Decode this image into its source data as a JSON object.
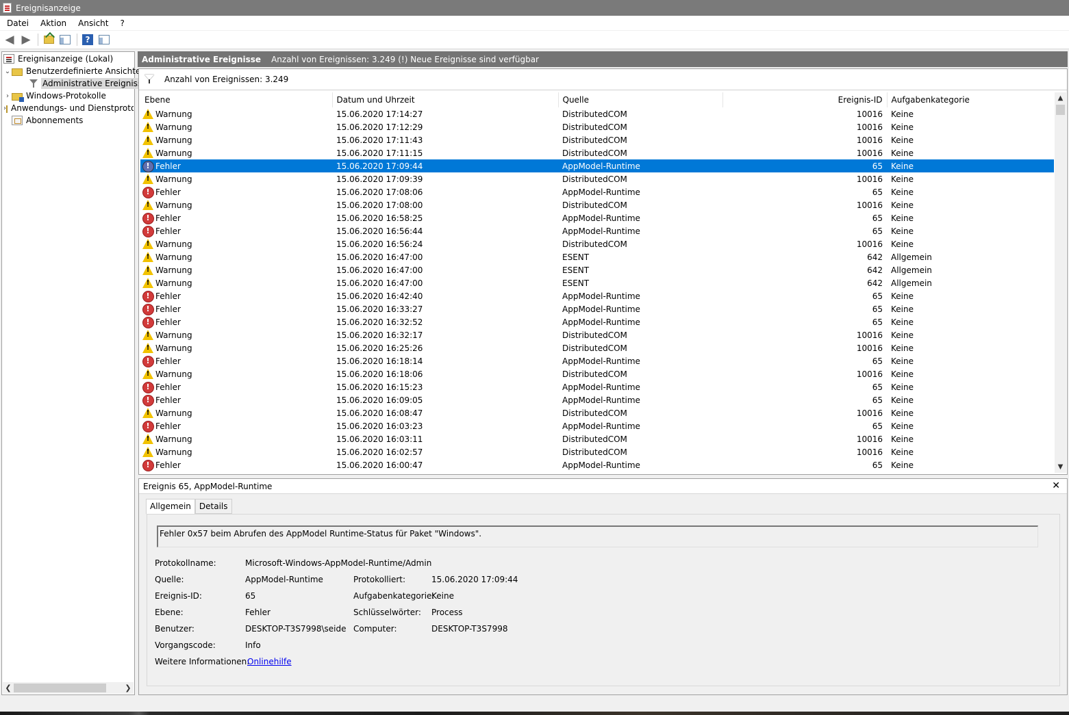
{
  "window": {
    "title": "Ereignisanzeige"
  },
  "menu": [
    "Datei",
    "Aktion",
    "Ansicht",
    "?"
  ],
  "tree": {
    "root": "Ereignisanzeige (Lokal)",
    "custom_views": "Benutzerdefinierte Ansichten",
    "admin_events": "Administrative Ereignisse",
    "windows_logs": "Windows-Protokolle",
    "app_logs": "Anwendungs- und Dienstprotokolle",
    "subscriptions": "Abonnements"
  },
  "header": {
    "title": "Administrative Ereignisse",
    "info": "Anzahl von Ereignissen: 3.249 (!) Neue Ereignisse sind verfügbar"
  },
  "filter_bar": {
    "text": "Anzahl von Ereignissen: 3.249"
  },
  "columns": [
    "Ebene",
    "Datum und Uhrzeit",
    "Quelle",
    "Ereignis-ID",
    "Aufgabenkategorie"
  ],
  "rows": [
    {
      "level": "Warnung",
      "type": "warn",
      "date": "15.06.2020 17:14:27",
      "source": "DistributedCOM",
      "id": "10016",
      "category": "Keine"
    },
    {
      "level": "Warnung",
      "type": "warn",
      "date": "15.06.2020 17:12:29",
      "source": "DistributedCOM",
      "id": "10016",
      "category": "Keine"
    },
    {
      "level": "Warnung",
      "type": "warn",
      "date": "15.06.2020 17:11:43",
      "source": "DistributedCOM",
      "id": "10016",
      "category": "Keine"
    },
    {
      "level": "Warnung",
      "type": "warn",
      "date": "15.06.2020 17:11:15",
      "source": "DistributedCOM",
      "id": "10016",
      "category": "Keine"
    },
    {
      "level": "Fehler",
      "type": "err",
      "date": "15.06.2020 17:09:44",
      "source": "AppModel-Runtime",
      "id": "65",
      "category": "Keine"
    },
    {
      "level": "Warnung",
      "type": "warn",
      "date": "15.06.2020 17:09:39",
      "source": "DistributedCOM",
      "id": "10016",
      "category": "Keine"
    },
    {
      "level": "Fehler",
      "type": "err",
      "date": "15.06.2020 17:08:06",
      "source": "AppModel-Runtime",
      "id": "65",
      "category": "Keine"
    },
    {
      "level": "Warnung",
      "type": "warn",
      "date": "15.06.2020 17:08:00",
      "source": "DistributedCOM",
      "id": "10016",
      "category": "Keine"
    },
    {
      "level": "Fehler",
      "type": "err",
      "date": "15.06.2020 16:58:25",
      "source": "AppModel-Runtime",
      "id": "65",
      "category": "Keine"
    },
    {
      "level": "Fehler",
      "type": "err",
      "date": "15.06.2020 16:56:44",
      "source": "AppModel-Runtime",
      "id": "65",
      "category": "Keine"
    },
    {
      "level": "Warnung",
      "type": "warn",
      "date": "15.06.2020 16:56:24",
      "source": "DistributedCOM",
      "id": "10016",
      "category": "Keine"
    },
    {
      "level": "Warnung",
      "type": "warn",
      "date": "15.06.2020 16:47:00",
      "source": "ESENT",
      "id": "642",
      "category": "Allgemein"
    },
    {
      "level": "Warnung",
      "type": "warn",
      "date": "15.06.2020 16:47:00",
      "source": "ESENT",
      "id": "642",
      "category": "Allgemein"
    },
    {
      "level": "Warnung",
      "type": "warn",
      "date": "15.06.2020 16:47:00",
      "source": "ESENT",
      "id": "642",
      "category": "Allgemein"
    },
    {
      "level": "Fehler",
      "type": "err",
      "date": "15.06.2020 16:42:40",
      "source": "AppModel-Runtime",
      "id": "65",
      "category": "Keine"
    },
    {
      "level": "Fehler",
      "type": "err",
      "date": "15.06.2020 16:33:27",
      "source": "AppModel-Runtime",
      "id": "65",
      "category": "Keine"
    },
    {
      "level": "Fehler",
      "type": "err",
      "date": "15.06.2020 16:32:52",
      "source": "AppModel-Runtime",
      "id": "65",
      "category": "Keine"
    },
    {
      "level": "Warnung",
      "type": "warn",
      "date": "15.06.2020 16:32:17",
      "source": "DistributedCOM",
      "id": "10016",
      "category": "Keine"
    },
    {
      "level": "Warnung",
      "type": "warn",
      "date": "15.06.2020 16:25:26",
      "source": "DistributedCOM",
      "id": "10016",
      "category": "Keine"
    },
    {
      "level": "Fehler",
      "type": "err",
      "date": "15.06.2020 16:18:14",
      "source": "AppModel-Runtime",
      "id": "65",
      "category": "Keine"
    },
    {
      "level": "Warnung",
      "type": "warn",
      "date": "15.06.2020 16:18:06",
      "source": "DistributedCOM",
      "id": "10016",
      "category": "Keine"
    },
    {
      "level": "Fehler",
      "type": "err",
      "date": "15.06.2020 16:15:23",
      "source": "AppModel-Runtime",
      "id": "65",
      "category": "Keine"
    },
    {
      "level": "Fehler",
      "type": "err",
      "date": "15.06.2020 16:09:05",
      "source": "AppModel-Runtime",
      "id": "65",
      "category": "Keine"
    },
    {
      "level": "Warnung",
      "type": "warn",
      "date": "15.06.2020 16:08:47",
      "source": "DistributedCOM",
      "id": "10016",
      "category": "Keine"
    },
    {
      "level": "Fehler",
      "type": "err",
      "date": "15.06.2020 16:03:23",
      "source": "AppModel-Runtime",
      "id": "65",
      "category": "Keine"
    },
    {
      "level": "Warnung",
      "type": "warn",
      "date": "15.06.2020 16:03:11",
      "source": "DistributedCOM",
      "id": "10016",
      "category": "Keine"
    },
    {
      "level": "Warnung",
      "type": "warn",
      "date": "15.06.2020 16:02:57",
      "source": "DistributedCOM",
      "id": "10016",
      "category": "Keine"
    },
    {
      "level": "Fehler",
      "type": "err",
      "date": "15.06.2020 16:00:47",
      "source": "AppModel-Runtime",
      "id": "65",
      "category": "Keine"
    }
  ],
  "selected_row": 4,
  "detail": {
    "title": "Ereignis 65, AppModel-Runtime",
    "tabs": [
      "Allgemein",
      "Details"
    ],
    "message": "Fehler 0x57 beim Abrufen des AppModel Runtime-Status für Paket \"Windows\".",
    "labels": {
      "log_name": "Protokollname:",
      "source": "Quelle:",
      "event_id": "Ereignis-ID:",
      "level": "Ebene:",
      "user": "Benutzer:",
      "opcode": "Vorgangscode:",
      "more_info": "Weitere Informationen:",
      "logged": "Protokolliert:",
      "task_category": "Aufgabenkategorie:",
      "keywords": "Schlüsselwörter:",
      "computer": "Computer:"
    },
    "values": {
      "log_name": "Microsoft-Windows-AppModel-Runtime/Admin",
      "source": "AppModel-Runtime",
      "event_id": "65",
      "level": "Fehler",
      "user": "DESKTOP-T3S7998\\seide",
      "opcode": "Info",
      "more_info": "Onlinehilfe",
      "logged": "15.06.2020 17:09:44",
      "task_category": "Keine",
      "keywords": "Process",
      "computer": "DESKTOP-T3S7998"
    }
  },
  "icons": {
    "warning": "warning-triangle-icon",
    "error": "error-circle-icon",
    "filter": "filter-icon",
    "back": "back-arrow-icon",
    "forward": "forward-arrow-icon"
  },
  "colors": {
    "selection": "#0078d7",
    "header_bar": "#747474",
    "warning": "#f2c200",
    "error": "#d23b3b"
  }
}
